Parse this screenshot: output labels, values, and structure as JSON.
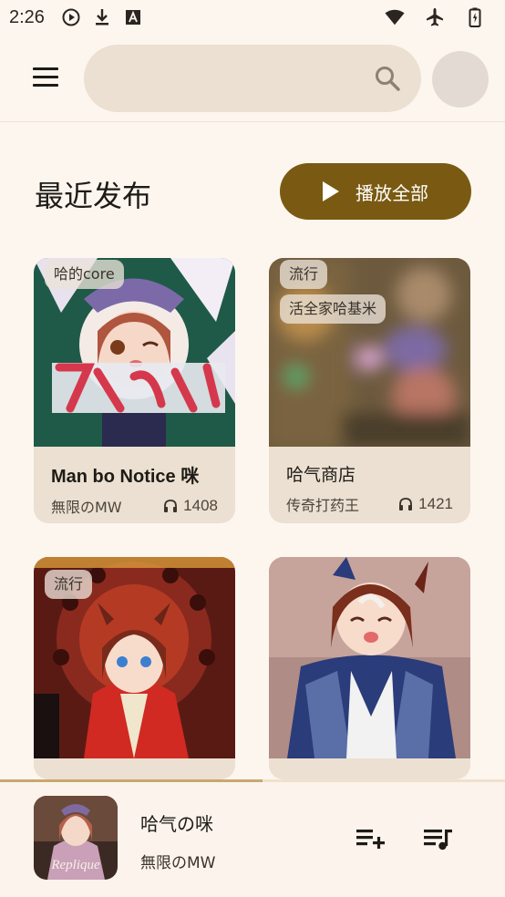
{
  "status_bar": {
    "time": "2:26",
    "icons": [
      "play-circle-icon",
      "download-icon",
      "font-a-icon",
      "wifi-icon",
      "airplane-icon",
      "battery-icon"
    ]
  },
  "app_bar": {
    "menu_icon": "menu-icon",
    "search": {
      "value": "",
      "placeholder": ""
    },
    "search_icon": "search-icon"
  },
  "section": {
    "title": "最近发布",
    "play_all_label": "播放全部"
  },
  "cards": [
    {
      "tags": [
        "哈的core"
      ],
      "title": "Man bo Notice 咪",
      "artist": "無限のMW",
      "plays": "1408"
    },
    {
      "tags": [
        "流行",
        "活全家哈基米"
      ],
      "title": "哈气商店",
      "artist": "传奇打药王",
      "plays": "1421"
    },
    {
      "tags": [
        "流行"
      ],
      "title": "",
      "artist": "",
      "plays": ""
    },
    {
      "tags": [],
      "title": "",
      "artist": "",
      "plays": ""
    }
  ],
  "player": {
    "song": "哈气の咪",
    "artist": "無限のMW",
    "progress": 0.52,
    "thumb_text": "Replique"
  },
  "colors": {
    "background": "#fdf6ef",
    "accent": "#7a5a12",
    "surface": "#ebe0d1"
  }
}
